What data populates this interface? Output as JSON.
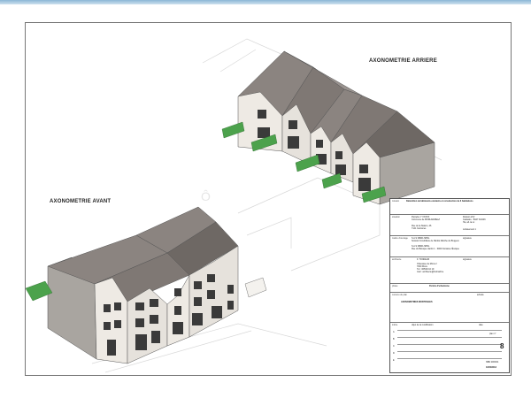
{
  "labels": {
    "rear_view": "AXONOMETRIE ARRIERE",
    "front_view": "AXONOMETRIE AVANT"
  },
  "watermark": "Ô",
  "title_block": {
    "mission_label": "mission",
    "mission_value": "Démolition de bâtiments existants et construction de 6 habitations",
    "situation_label": "situation",
    "situation_lines": [
      "Parcelle n° XXXXX",
      "Commune de MORLANWELZ",
      "Rue de la Station, 46",
      "7141 Carnières"
    ],
    "client_lines": [
      "Division 2/IV",
      "Cadastre : B447 K4/446",
      "Ha, a3 ca xx"
    ],
    "issue_label": "Lotissement 1",
    "owner_label": "maître d'ouvrage",
    "owner_lines": [
      "S.A.S IMMO-SPRL",
      "Société Immobilière de l'Entité Marche du Brugeux",
      "S.A.S IMMO-SPRL",
      "Rue du Baroque Jardin 1 · 6000 Fontaine-l'Évêque"
    ],
    "signature_label": "signature",
    "author_label": "architecte",
    "author_lines": [
      "F. TONDEUR",
      "Chaussée de Mons 2",
      "7000 Mons",
      "Tél : 065/49 10 19",
      "mail : architecte@hotmail.be"
    ],
    "phase_label": "phase",
    "phase_value": "Permis d'urbanisme",
    "plan_label": "contenu du plan",
    "plan_value": "AXONOMETRIES MONTRAGES",
    "echelle_label": "échelle",
    "index_label": "indice",
    "revision_label": "objet de la modification",
    "date_label": "date",
    "revisions": [
      "A",
      "B",
      "C",
      "D",
      "E"
    ],
    "sheet_label": "plan n°",
    "sheet_number": "8",
    "project_code": "NBD 2000/01",
    "issue_date": "10/03/2012"
  },
  "colors": {
    "roof": "#8b8480",
    "roof_dark": "#6e6864",
    "wall": "#eeeae4",
    "wall_shade": "#a9a5a0",
    "hedge": "#4ca24c",
    "line": "#555555"
  }
}
